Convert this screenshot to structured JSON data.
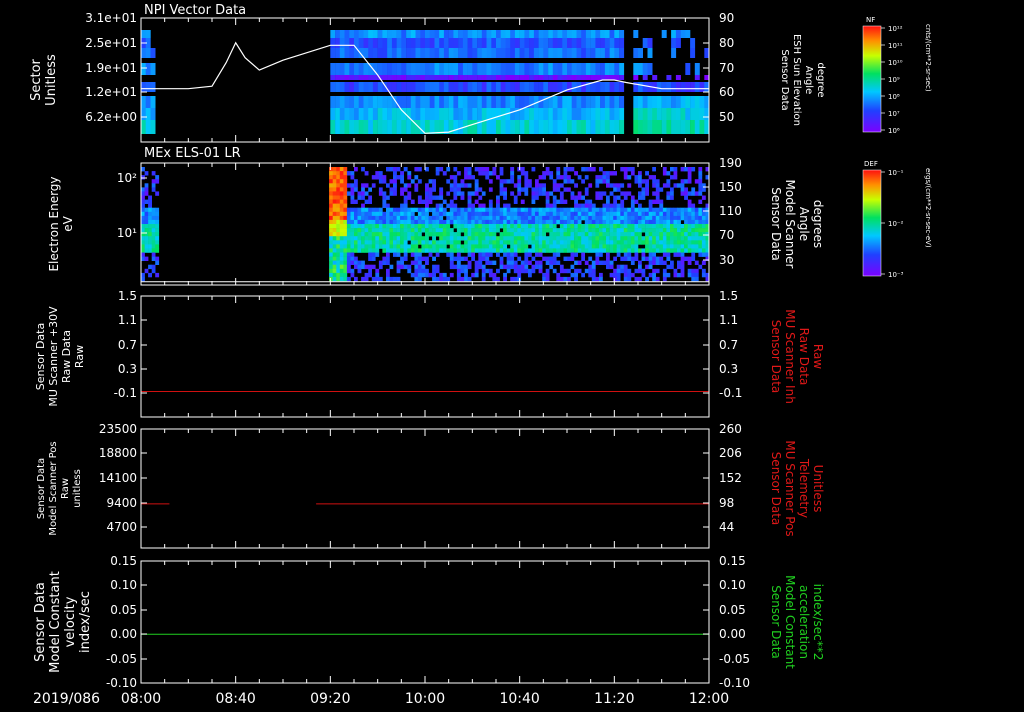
{
  "time_axis": {
    "date_label": "2019/086",
    "tick_labels": [
      "08:00",
      "08:40",
      "09:20",
      "10:00",
      "10:40",
      "11:20",
      "12:00"
    ],
    "range": [
      "08:00",
      "12:00"
    ]
  },
  "colors": {
    "background": "#000000",
    "axes": "#ffffff",
    "red_line": "#d01010",
    "green_line": "#20d020",
    "red_label": "#e01818",
    "green_label": "#20d020"
  },
  "chart_data": [
    {
      "id": "panel1",
      "type": "heatmap",
      "title": "NPI Vector Data",
      "ylabel_left": [
        "Sector",
        "Unitless"
      ],
      "ylabel_right": [
        "Sensor Data",
        "ESH Sun Elevation",
        "Angle",
        "degree"
      ],
      "left_ticks": [
        "3.1e+01",
        "2.5e+01",
        "1.9e+01",
        "1.2e+01",
        "6.2e+00"
      ],
      "right_ticks": [
        "90",
        "80",
        "70",
        "60",
        "50"
      ],
      "right_ylim": [
        40,
        90
      ],
      "colorbar": {
        "label": "NF",
        "units": "cnts/(cm**2-sr-sec)",
        "ticks": [
          "10¹²",
          "10¹¹",
          "10¹⁰",
          "10⁹",
          "10⁸",
          "10⁷",
          "10⁶"
        ]
      },
      "data_gaps": [
        [
          "08:05",
          "09:20"
        ],
        [
          "11:23",
          "11:27"
        ]
      ],
      "line_series": {
        "name": "ESH Sun Elevation Angle",
        "color": "#ffffff",
        "time": [
          "08:00",
          "08:20",
          "08:30",
          "08:36",
          "08:40",
          "08:44",
          "08:50",
          "09:00",
          "09:20",
          "09:30",
          "09:40",
          "09:50",
          "10:00",
          "10:10",
          "10:20",
          "10:40",
          "11:00",
          "11:15",
          "11:20",
          "11:25",
          "11:40",
          "12:00"
        ],
        "value": [
          61.5,
          61.5,
          62.5,
          72,
          80,
          74,
          69,
          73,
          79,
          79,
          67,
          53,
          43.5,
          44,
          47,
          53,
          61,
          65,
          65,
          64,
          61.5,
          61.5
        ]
      }
    },
    {
      "id": "panel2",
      "type": "heatmap",
      "title": "MEx ELS-01 LR",
      "ylabel_left": [
        "Electron Energy",
        "eV"
      ],
      "ylabel_right": [
        "Sensor Data",
        "Model Scanner",
        "Angle",
        "degrees"
      ],
      "left_ticks": [
        "10²",
        "10¹"
      ],
      "right_ticks": [
        "190",
        "150",
        "110",
        "70",
        "30"
      ],
      "right_ylim": [
        0,
        190
      ],
      "colorbar": {
        "label": "DEF",
        "units": "ergs/(cm**2-sr-sec-eV)",
        "ticks": [
          "10⁻¹",
          "10⁻²",
          "10⁻³"
        ]
      },
      "data_gaps": [
        [
          "08:07",
          "09:19"
        ]
      ],
      "line_series": {
        "name": "Model Scanner Angle",
        "color": "#ffffff",
        "time": [
          "08:00",
          "12:00"
        ],
        "value": [
          5,
          5
        ]
      }
    },
    {
      "id": "panel3",
      "type": "line",
      "ylabel_left": [
        "Sensor Data",
        "MU Scanner +30V",
        "Raw Data",
        "Raw"
      ],
      "ylabel_right": [
        "Sensor Data",
        "MU Scanner Inh",
        "Raw Data",
        "Raw"
      ],
      "left_ticks": [
        "1.5",
        "1.1",
        "0.7",
        "0.3",
        "-0.1"
      ],
      "right_ticks": [
        "1.5",
        "1.1",
        "0.7",
        "0.3",
        "-0.1"
      ],
      "ylim": [
        -0.4,
        1.5
      ],
      "series": [
        {
          "name": "MU Scanner Inh Raw Data",
          "color": "#d01010",
          "time": [
            "08:00",
            "12:00"
          ],
          "value": [
            0.0,
            0.0
          ]
        }
      ]
    },
    {
      "id": "panel4",
      "type": "line",
      "ylabel_left": [
        "Sensor Data",
        "Model Scanner Pos",
        "Raw",
        "unitless"
      ],
      "ylabel_right": [
        "Sensor Data",
        "MU Scanner Pos",
        "Telemetry",
        "Unitless"
      ],
      "left_ticks": [
        "23500",
        "18800",
        "14100",
        "9400",
        "4700"
      ],
      "right_ticks": [
        "260",
        "206",
        "152",
        "98",
        "44"
      ],
      "right_ylim": [
        -10,
        260
      ],
      "series": [
        {
          "name": "MU Scanner Pos Telemetry",
          "color": "#d01010",
          "time": [
            "08:00",
            "08:12"
          ],
          "value": [
            90,
            90
          ]
        },
        {
          "name": "MU Scanner Pos Telemetry",
          "color": "#d01010",
          "time": [
            "09:14",
            "12:00"
          ],
          "value": [
            90,
            90
          ]
        }
      ]
    },
    {
      "id": "panel5",
      "type": "line",
      "ylabel_left": [
        "Sensor Data",
        "Model Constant",
        "velocity",
        "index/sec"
      ],
      "ylabel_right": [
        "Sensor Data",
        "Model Constant",
        "acceleration",
        "index/sec**2"
      ],
      "left_ticks": [
        "0.15",
        "0.10",
        "0.05",
        "0.00",
        "-0.05",
        "-0.10"
      ],
      "right_ticks": [
        "0.15",
        "0.10",
        "0.05",
        "0.00",
        "-0.05",
        "-0.10"
      ],
      "ylim": [
        -0.1,
        0.15
      ],
      "series": [
        {
          "name": "Model Constant acceleration",
          "color": "#20d020",
          "time": [
            "08:00",
            "12:00"
          ],
          "value": [
            0.0,
            0.0
          ]
        }
      ]
    }
  ]
}
